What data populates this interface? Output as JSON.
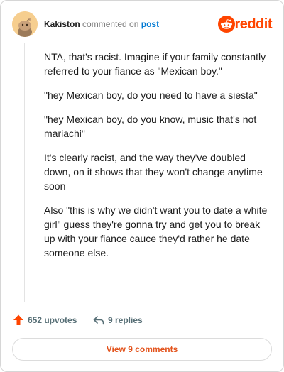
{
  "header": {
    "username": "Kakiston",
    "action_text": "commented on",
    "post_link": "post",
    "brand_wordmark": "reddit"
  },
  "comment": {
    "paragraphs": [
      "NTA, that's racist. Imagine if your family constantly referred to your fiance as \"Mexican boy.\"",
      "\"hey Mexican boy, do you need to have a siesta\"",
      "\"hey Mexican boy, do you know, music that's not mariachi\"",
      "It's clearly racist, and the way they've doubled down, on it shows that they won't change anytime soon",
      "Also \"this is why we didn't want you to date a white girl\" guess they're gonna try and get you to break up with your fiance cauce they'd rather he date someone else."
    ]
  },
  "footer": {
    "upvotes_label": "652 upvotes",
    "replies_label": "9 replies",
    "view_comments_label": "View 9 comments"
  },
  "icons": {
    "avatar": "snoo-avatar-icon",
    "brand": "reddit-logo-icon",
    "upvote": "upvote-arrow-icon",
    "reply": "reply-arrow-icon"
  },
  "colors": {
    "brand_orange": "#ff4500",
    "link_blue": "#0079d3",
    "meta_gray": "#7c7c7c",
    "footer_gray": "#576f76",
    "view_button_text": "#e3531c"
  }
}
